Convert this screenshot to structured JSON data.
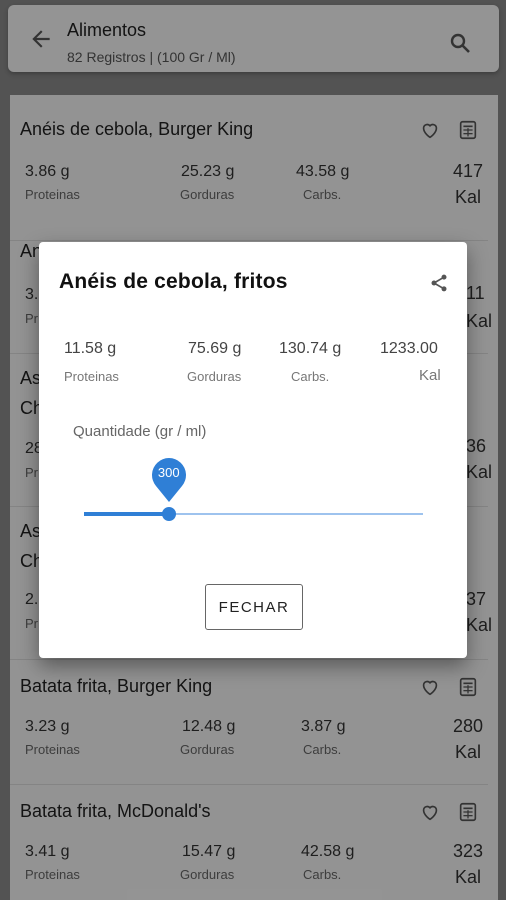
{
  "header": {
    "title": "Alimentos",
    "subtitle": "82 Registros | (100 Gr / Ml)"
  },
  "items": [
    {
      "name": "Anéis de cebola, Burger King",
      "proteinas": "3.86 g",
      "gorduras": "25.23 g",
      "carbs": "43.58 g",
      "kal": "417"
    },
    {
      "name": "An",
      "proteinas": "3.",
      "gorduras": "",
      "carbs": "",
      "kal": "11"
    },
    {
      "name": "As",
      "name2": "Ch",
      "proteinas": "28",
      "gorduras": "",
      "carbs": "",
      "kal": "36"
    },
    {
      "name": "As",
      "name2": "Ch",
      "proteinas": "2.",
      "gorduras": "",
      "carbs": "",
      "kal": "37"
    },
    {
      "name": "Batata frita, Burger King",
      "proteinas": "3.23 g",
      "gorduras": "12.48 g",
      "carbs": "3.87 g",
      "kal": "280"
    },
    {
      "name": "Batata frita, McDonald's",
      "proteinas": "3.41 g",
      "gorduras": "15.47 g",
      "carbs": "42.58 g",
      "kal": "323"
    }
  ],
  "labels": {
    "proteinas": "Proteinas",
    "proteinas_trunc": "Pr",
    "gorduras": "Gorduras",
    "carbs": "Carbs.",
    "kal": "Kal"
  },
  "dialog": {
    "title": "Anéis de cebola, fritos",
    "proteinas": "11.58 g",
    "gorduras": "75.69 g",
    "carbs": "130.74 g",
    "kal": "1233.00",
    "quantity_label": "Quantidade (gr / ml)",
    "slider_value": "300",
    "close_label": "FECHAR"
  },
  "slider": {
    "value": 300,
    "fraction": 0.25
  },
  "colors": {
    "accent": "#2f7fd6",
    "track": "#9ec3ee",
    "scrim": "rgba(0,0,0,0.40)"
  },
  "icons": [
    "arrow-back-icon",
    "search-icon",
    "heart-outline-icon",
    "calculator-icon",
    "share-icon"
  ]
}
